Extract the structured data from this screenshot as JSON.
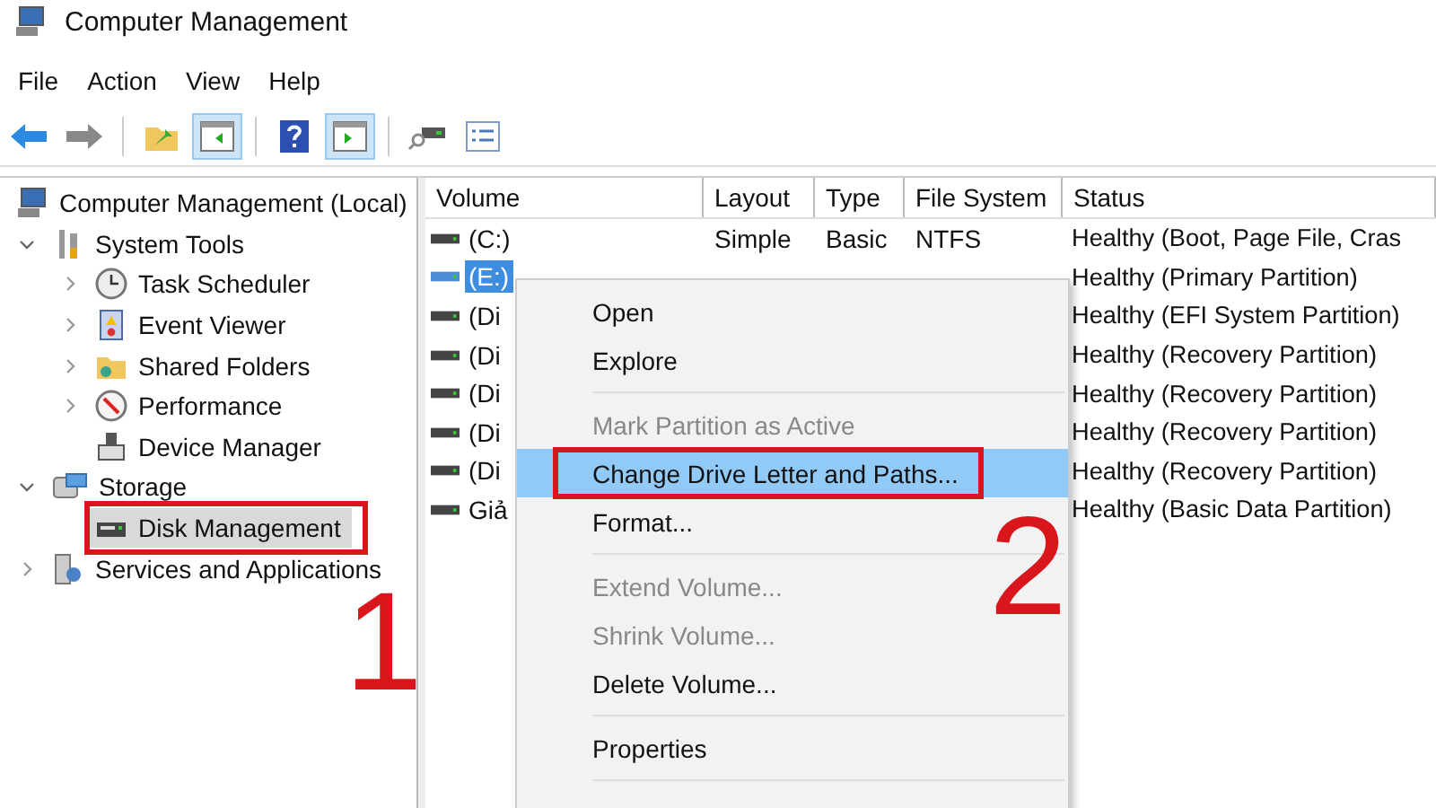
{
  "window": {
    "title": "Computer Management"
  },
  "menu_bar": [
    "File",
    "Action",
    "View",
    "Help"
  ],
  "toolbar": [
    [
      {
        "kind": "back",
        "pressed": false
      },
      {
        "kind": "forward",
        "pressed": false
      }
    ],
    [
      {
        "kind": "up",
        "pressed": false
      },
      {
        "kind": "tree",
        "pressed": true
      }
    ],
    [
      {
        "kind": "help",
        "pressed": false
      },
      {
        "kind": "pane",
        "pressed": true
      }
    ],
    [
      {
        "kind": "connect",
        "pressed": false
      },
      {
        "kind": "list",
        "pressed": false
      }
    ]
  ],
  "tree": [
    {
      "label": "Computer Management (Local)",
      "kind": "computer",
      "selected": false,
      "annotated": false,
      "children": [
        {
          "label": "System Tools",
          "kind": "tools",
          "expanded": true,
          "selected": false,
          "annotated": false,
          "children": [
            {
              "label": "Task Scheduler",
              "kind": "clock",
              "expanded": false,
              "selected": false,
              "annotated": false
            },
            {
              "label": "Event Viewer",
              "kind": "log",
              "expanded": false,
              "selected": false,
              "annotated": false
            },
            {
              "label": "Shared Folders",
              "kind": "folder",
              "expanded": false,
              "selected": false,
              "annotated": false
            },
            {
              "label": "Performance",
              "kind": "gauge",
              "expanded": false,
              "selected": false,
              "annotated": false
            },
            {
              "label": "Device Manager",
              "kind": "device",
              "selected": false,
              "annotated": false
            }
          ]
        },
        {
          "label": "Storage",
          "kind": "storage",
          "expanded": true,
          "selected": false,
          "annotated": false,
          "children": [
            {
              "label": "Disk Management",
              "kind": "disk",
              "selected": true,
              "annotated": true
            }
          ]
        },
        {
          "label": "Services and Applications",
          "kind": "services",
          "expanded": false,
          "selected": false,
          "annotated": false
        }
      ]
    }
  ],
  "table": {
    "columns": [
      "Volume",
      "Layout",
      "Type",
      "File System",
      "Status"
    ],
    "rows": [
      {
        "volume": "(C:)",
        "layout": "Simple",
        "type": "Basic",
        "file_system": "NTFS",
        "status": "Healthy (Boot, Page File, Cras",
        "selected": false
      },
      {
        "volume": "(E:)",
        "status": "Healthy (Primary Partition)",
        "selected": true
      },
      {
        "volume": "(Di",
        "status": "Healthy (EFI System Partition)",
        "selected": false
      },
      {
        "volume": "(Di",
        "status": "Healthy (Recovery Partition)",
        "selected": false
      },
      {
        "volume": "(Di",
        "status": "Healthy (Recovery Partition)",
        "selected": false
      },
      {
        "volume": "(Di",
        "status": "Healthy (Recovery Partition)",
        "selected": false
      },
      {
        "volume": "(Di",
        "status": "Healthy (Recovery Partition)",
        "selected": false
      },
      {
        "volume": "Giả",
        "status": "Healthy (Basic Data Partition)",
        "selected": false
      }
    ]
  },
  "context_menu": [
    {
      "kind": "item",
      "label": "Open",
      "disabled": false,
      "selected": false,
      "annotated": false
    },
    {
      "kind": "item",
      "label": "Explore",
      "disabled": false,
      "selected": false,
      "annotated": false
    },
    {
      "kind": "separator"
    },
    {
      "kind": "item",
      "label": "Mark Partition as Active",
      "disabled": true,
      "selected": false,
      "annotated": false
    },
    {
      "kind": "item",
      "label": "Change Drive Letter and Paths...",
      "disabled": false,
      "selected": true,
      "annotated": true
    },
    {
      "kind": "item",
      "label": "Format...",
      "disabled": false,
      "selected": false,
      "annotated": false
    },
    {
      "kind": "separator"
    },
    {
      "kind": "item",
      "label": "Extend Volume...",
      "disabled": true,
      "selected": false,
      "annotated": false
    },
    {
      "kind": "item",
      "label": "Shrink Volume...",
      "disabled": true,
      "selected": false,
      "annotated": false
    },
    {
      "kind": "item",
      "label": "Delete Volume...",
      "disabled": false,
      "selected": false,
      "annotated": false
    },
    {
      "kind": "separator"
    },
    {
      "kind": "item",
      "label": "Properties",
      "disabled": false,
      "selected": false,
      "annotated": false
    },
    {
      "kind": "separator"
    }
  ],
  "annotations": [
    "1",
    "2"
  ]
}
